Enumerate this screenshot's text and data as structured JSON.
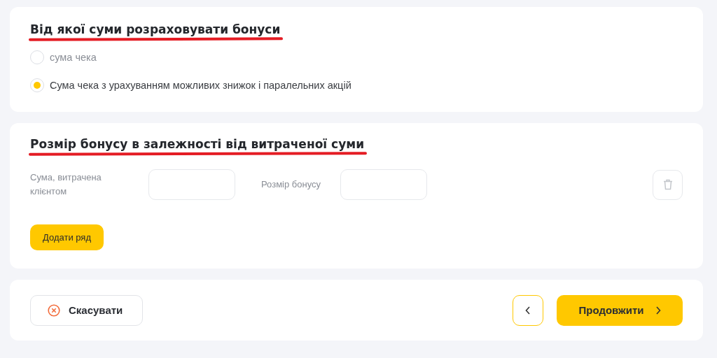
{
  "basis_section": {
    "title": "Від якої суми розраховувати бонуси",
    "underlined": true,
    "options": [
      {
        "label": "сума чека",
        "selected": false
      },
      {
        "label": "Сума чека з урахуванням можливих знижок і паралельних акцій",
        "selected": true
      }
    ]
  },
  "bonus_section": {
    "title": "Розмір бонусу в залежності від витраченої суми",
    "underlined": true,
    "rows": [
      {
        "spent_label": "Сума, витрачена клієнтом",
        "bonus_label": "Розмір бонусу",
        "delete_disabled": true
      }
    ],
    "add_row_button": "Додати ряд"
  },
  "footer": {
    "cancel_button": "Скасувати",
    "continue_button": "Продовжити"
  }
}
